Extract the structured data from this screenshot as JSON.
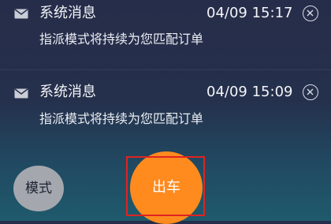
{
  "colors": {
    "accent_orange": "#ff8a1e",
    "mode_button_gray": "#a4a8ae",
    "highlight_red": "#e02320"
  },
  "notifications": [
    {
      "icon": "mail-icon",
      "title": "系统消息",
      "time": "04/09 15:17",
      "body": "指派模式将持续为您匹配订单"
    },
    {
      "icon": "mail-icon",
      "title": "系统消息",
      "time": "04/09 15:09",
      "body": "指派模式将持续为您匹配订单"
    }
  ],
  "buttons": {
    "mode": "模式",
    "depart": "出车"
  }
}
